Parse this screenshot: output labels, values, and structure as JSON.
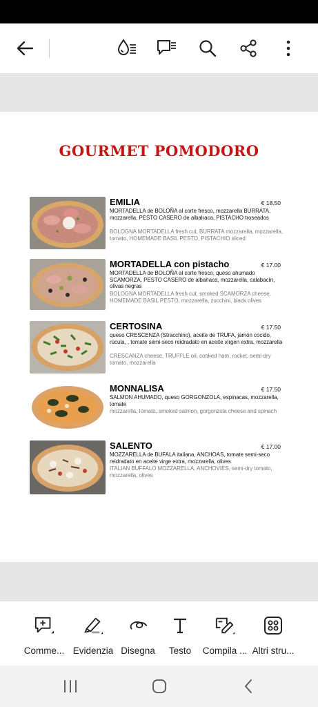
{
  "menu": {
    "title": "GOURMET POMODORO",
    "items": [
      {
        "name": "EMILIA",
        "price": "€ 18.50",
        "description_it": "MORTADELLA de BOLOÑA al corte fresco, mozzarella BURRATA, mozzarella, PESTO CASERO de albahaca, PISTACHO troseados",
        "description_en": "BOLOGNA MORTADELLA fresh cut, BURRATA mozzarella, mozzarella, tomato, HOMEMADE BASIL PESTO, PISTACHIO sliced"
      },
      {
        "name": "MORTADELLA con pistacho",
        "price": "€ 17.00",
        "description_it": "MORTADELLA de BOLOÑA al corte fresco, queso ahumado SCAMORZA, PESTO CASERO de albahaca, mozzarella, calabacín, olivas negras",
        "description_en": "BOLOGNA MORTADELLA fresh cut, smoked SCAMORZA cheese, HOMEMADE BASIL PESTO, mozzarella, zucchini, black olives"
      },
      {
        "name": "CERTOSINA",
        "price": "€ 17.50",
        "description_it": "queso CRESCENZA (Stracchino), aceite de TRUFA, jamón cocido, rúcula, , tomate semi-seco  reidradato en aceite virgen extra, mozzarella",
        "description_en": "CRESCANZA cheese, TRUFFLE oil, cooked ham, rocket, semi-dry tomato, mozzarella"
      },
      {
        "name": "MONNALISA",
        "price": "€ 17.50",
        "description_it": "SALMON AHUMADO, queso GORGONZOLA, espinacas, mozzarella, tomate",
        "description_en": "mozzarella, tomato, smoked salmon, gorgonzola cheese and spinach"
      },
      {
        "name": "SALENTO",
        "price": "€ 17.00",
        "description_it": "MOZZARELLA de BUFALA italiana, ANCHOAS, tomate semi-seco  reidradato en aceite virge extra, mozzarella, olives",
        "description_en": "ITALIAN BUFFALO MOZZARELLA, ANCHOVIES, semi-dry tomato, mozzarella, olives"
      }
    ]
  },
  "toolbar": {
    "icons": [
      "back-arrow-icon",
      "reading-mode-icon",
      "comments-list-icon",
      "search-icon",
      "share-icon",
      "more-vertical-icon"
    ]
  },
  "bottom_tools": [
    {
      "label": "Comme...",
      "icon": "comment-add-icon"
    },
    {
      "label": "Evidenzia",
      "icon": "highlighter-icon"
    },
    {
      "label": "Disegna",
      "icon": "draw-icon"
    },
    {
      "label": "Testo",
      "icon": "text-icon"
    },
    {
      "label": "Compila ...",
      "icon": "fill-sign-icon"
    },
    {
      "label": "Altri stru...",
      "icon": "more-tools-icon"
    }
  ],
  "colors": {
    "title_red": "#c41414",
    "english_gray": "#777777",
    "band_gray": "#e6e6e6"
  }
}
